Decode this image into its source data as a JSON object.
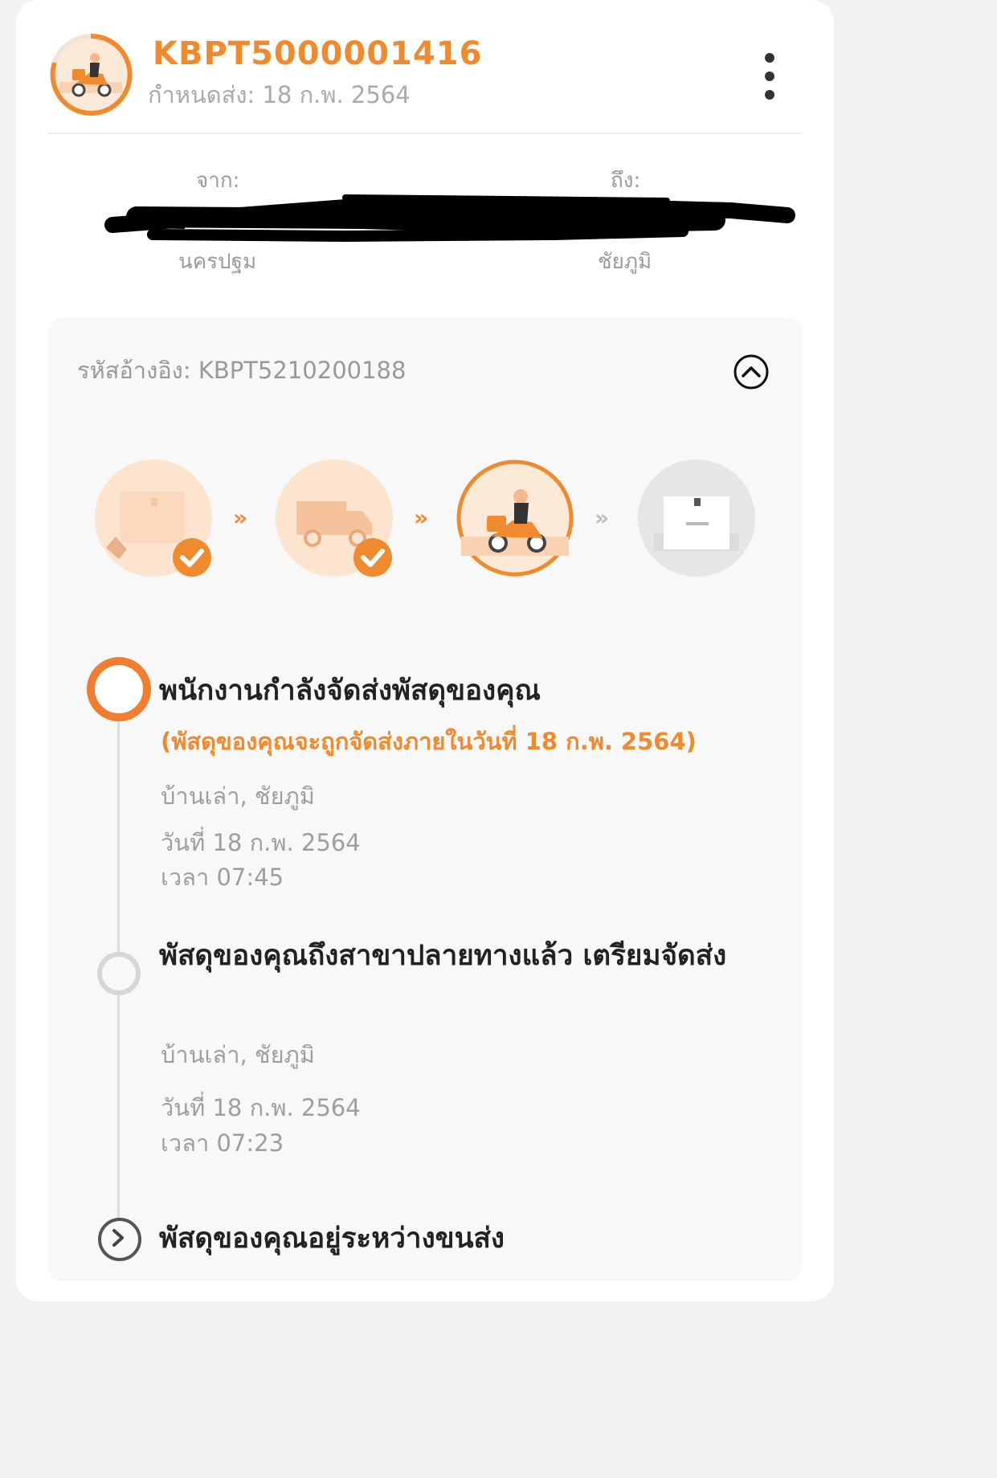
{
  "header": {
    "tracking_number": "KBPT5000001416",
    "due_date": "กำหนดส่ง: 18 ก.พ. 2564",
    "more_icon": "more-vertical-icon"
  },
  "route": {
    "from_label": "จาก:",
    "from_city": "นครปฐม",
    "to_label": "ถึง:",
    "to_city": "ชัยภูมิ"
  },
  "panel": {
    "reference": "รหัสอ้างอิง: KBPT5210200188",
    "collapse_icon": "chevron-up-icon"
  },
  "progress": {
    "steps": [
      {
        "name": "parcel-received",
        "completed": true
      },
      {
        "name": "in-transit-truck",
        "completed": true
      },
      {
        "name": "out-for-delivery",
        "current": true
      },
      {
        "name": "delivered",
        "completed": false
      }
    ],
    "separator": "»",
    "accent_color": "#f08a2e"
  },
  "timeline": [
    {
      "title": "พนักงานกำลังจัดส่งพัสดุของคุณ",
      "note": "(พัสดุของคุณจะถูกจัดส่งภายในวันที่ 18 ก.พ. 2564)",
      "location": "บ้านเล่า, ชัยภูมิ",
      "date": "วันที่ 18 ก.พ. 2564",
      "time": "เวลา 07:45"
    },
    {
      "title": "พัสดุของคุณถึงสาขาปลายทางแล้ว เตรียมจัดส่ง",
      "location": "บ้านเล่า, ชัยภูมิ",
      "date": "วันที่ 18 ก.พ. 2564",
      "time": "เวลา 07:23"
    },
    {
      "title": "พัสดุของคุณอยู่ระหว่างขนส่ง"
    }
  ]
}
